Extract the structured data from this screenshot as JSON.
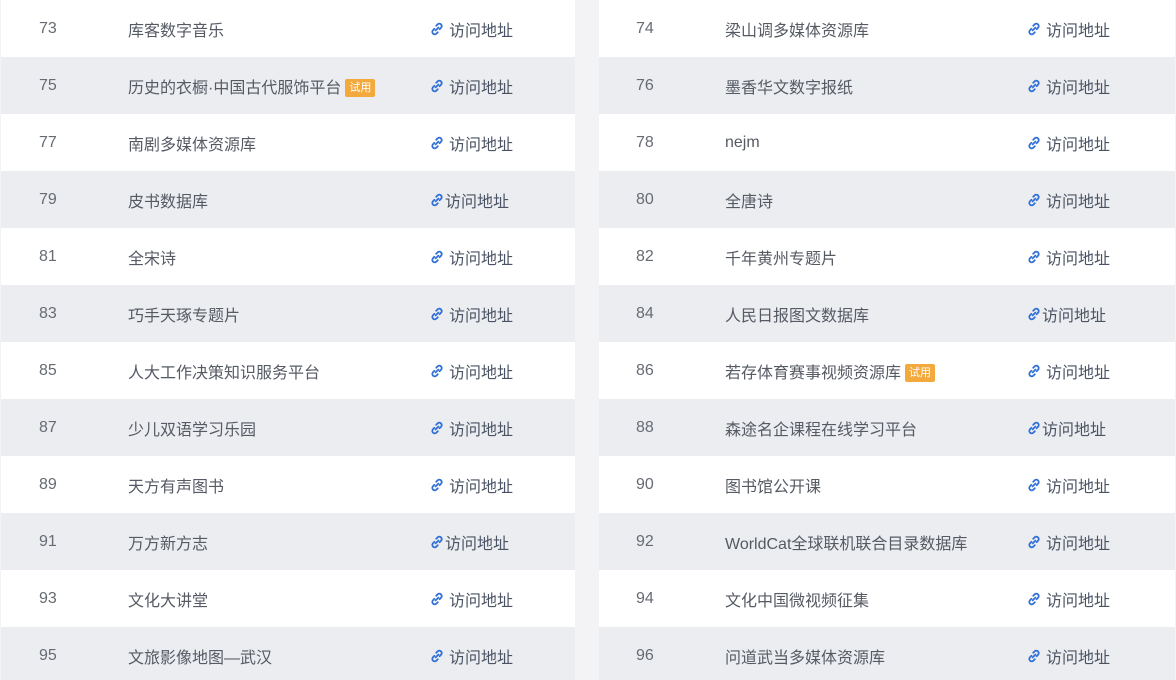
{
  "link_label": "访问地址",
  "trial_label": "试用",
  "left_rows": [
    {
      "num": "73",
      "name": "库客数字音乐",
      "trial": false,
      "tight": false
    },
    {
      "num": "75",
      "name": "历史的衣橱·中国古代服饰平台",
      "trial": true,
      "tight": false
    },
    {
      "num": "77",
      "name": "南剧多媒体资源库",
      "trial": false,
      "tight": false
    },
    {
      "num": "79",
      "name": "皮书数据库",
      "trial": false,
      "tight": true
    },
    {
      "num": "81",
      "name": "全宋诗",
      "trial": false,
      "tight": false
    },
    {
      "num": "83",
      "name": "巧手天琢专题片",
      "trial": false,
      "tight": false
    },
    {
      "num": "85",
      "name": "人大工作决策知识服务平台",
      "trial": false,
      "tight": false
    },
    {
      "num": "87",
      "name": "少儿双语学习乐园",
      "trial": false,
      "tight": false
    },
    {
      "num": "89",
      "name": "天方有声图书",
      "trial": false,
      "tight": false
    },
    {
      "num": "91",
      "name": "万方新方志",
      "trial": false,
      "tight": true
    },
    {
      "num": "93",
      "name": "文化大讲堂",
      "trial": false,
      "tight": false
    },
    {
      "num": "95",
      "name": "文旅影像地图—武汉",
      "trial": false,
      "tight": false
    }
  ],
  "right_rows": [
    {
      "num": "74",
      "name": "梁山调多媒体资源库",
      "trial": false,
      "tight": false
    },
    {
      "num": "76",
      "name": "墨香华文数字报纸",
      "trial": false,
      "tight": false
    },
    {
      "num": "78",
      "name": "nejm",
      "trial": false,
      "tight": false
    },
    {
      "num": "80",
      "name": "全唐诗",
      "trial": false,
      "tight": false
    },
    {
      "num": "82",
      "name": "千年黄州专题片",
      "trial": false,
      "tight": false
    },
    {
      "num": "84",
      "name": "人民日报图文数据库",
      "trial": false,
      "tight": true
    },
    {
      "num": "86",
      "name": "若存体育赛事视频资源库",
      "trial": true,
      "tight": false
    },
    {
      "num": "88",
      "name": "森途名企课程在线学习平台",
      "trial": false,
      "tight": true
    },
    {
      "num": "90",
      "name": "图书馆公开课",
      "trial": false,
      "tight": false
    },
    {
      "num": "92",
      "name": "WorldCat全球联机联合目录数据库",
      "trial": false,
      "tight": false
    },
    {
      "num": "94",
      "name": "文化中国微视频征集",
      "trial": false,
      "tight": false
    },
    {
      "num": "96",
      "name": "问道武当多媒体资源库",
      "trial": false,
      "tight": false
    }
  ]
}
